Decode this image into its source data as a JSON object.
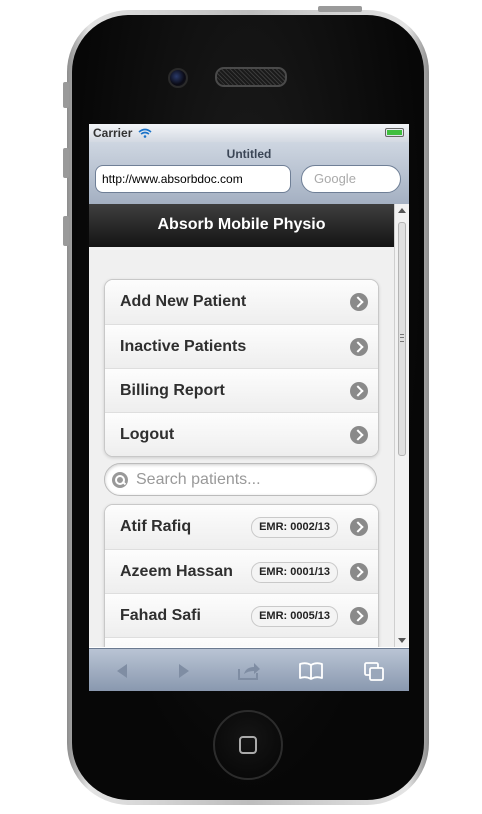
{
  "status_bar": {
    "carrier": "Carrier"
  },
  "browser": {
    "page_title": "Untitled",
    "url": "http://www.absorbdoc.com",
    "search_placeholder": "Google"
  },
  "app": {
    "title": "Absorb Mobile Physio",
    "menu": [
      {
        "label": "Add New Patient"
      },
      {
        "label": "Inactive Patients"
      },
      {
        "label": "Billing Report"
      },
      {
        "label": "Logout"
      }
    ],
    "search_placeholder": "Search patients...",
    "patients": [
      {
        "name": "Atif Rafiq",
        "emr": "EMR: 0002/13"
      },
      {
        "name": "Azeem Hassan",
        "emr": "EMR: 0001/13"
      },
      {
        "name": "Fahad Safi",
        "emr": "EMR: 0005/13"
      }
    ]
  },
  "toolbar_icons": [
    "back-icon",
    "forward-icon",
    "share-icon",
    "bookmarks-icon",
    "tabs-icon"
  ],
  "colors": {
    "header_bg": "#1e1e1e",
    "accent_battery": "#3fbf3f",
    "toolbar_bg": "#9aa7ba"
  }
}
